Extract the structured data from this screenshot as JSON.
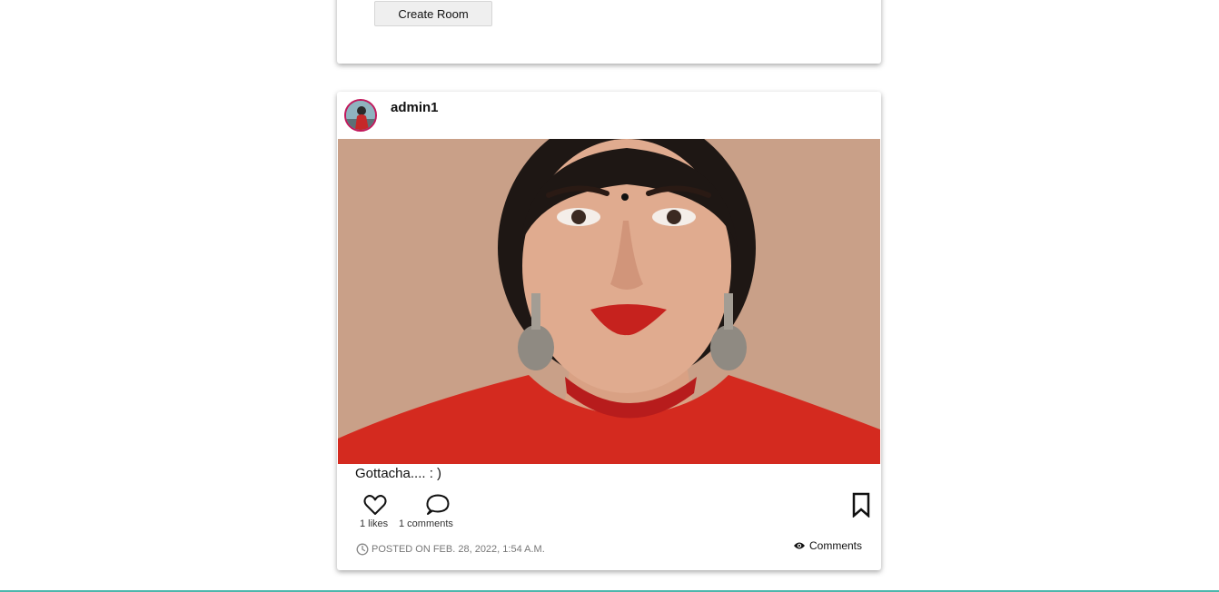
{
  "room_card": {
    "create_room_label": "Create Room"
  },
  "post": {
    "username": "admin1",
    "caption": "Gottacha.... : )",
    "likes_text": "1 likes",
    "comments_count_text": "1 comments",
    "posted_text": "POSTED ON FEB. 28, 2022, 1:54 A.M.",
    "comments_link_label": "Comments",
    "image_description_icon": "portrait-photo"
  },
  "icons": {
    "like": "heart-icon",
    "comment": "speech-bubble-icon",
    "bookmark": "bookmark-icon",
    "clock": "clock-icon",
    "eye": "eye-icon"
  },
  "colors": {
    "avatar_ring": "#c2185b",
    "accent_line": "#4db6ac",
    "button_bg": "#efefef"
  }
}
